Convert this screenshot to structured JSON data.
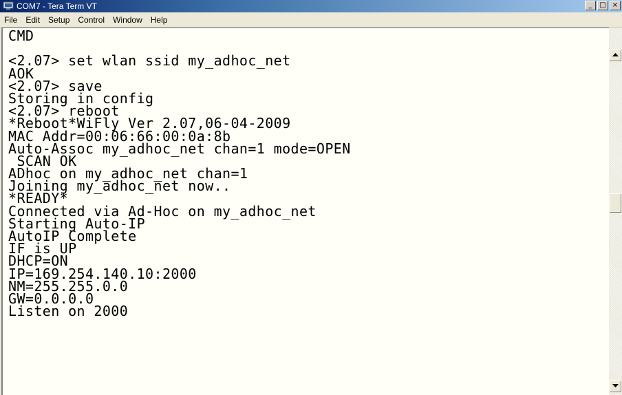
{
  "window": {
    "title": "COM7 - Tera Term VT",
    "app_icon": "tera-term-icon",
    "controls": {
      "minimize": "_",
      "maximize": "□",
      "close": "×"
    }
  },
  "menu": {
    "items": [
      {
        "label": "File"
      },
      {
        "label": "Edit"
      },
      {
        "label": "Setup"
      },
      {
        "label": "Control"
      },
      {
        "label": "Window"
      },
      {
        "label": "Help"
      }
    ]
  },
  "terminal": {
    "lines": [
      "CMD",
      "",
      "<2.07> set wlan ssid my_adhoc_net",
      "AOK",
      "<2.07> save",
      "Storing in config",
      "<2.07> reboot",
      "*Reboot*WiFly Ver 2.07,06-04-2009",
      "MAC Addr=00:06:66:00:0a:8b",
      "Auto-Assoc my_adhoc_net chan=1 mode=OPEN",
      " SCAN OK",
      "ADhoc on my_adhoc_net chan=1",
      "Joining my_adhoc_net now..",
      "*READY*",
      "Connected via Ad-Hoc on my_adhoc_net",
      "Starting Auto-IP",
      "AutoIP Complete",
      "IF is UP",
      "DHCP=ON",
      "IP=169.254.140.10:2000",
      "NM=255.255.0.0",
      "GW=0.0.0.0",
      "Listen on 2000"
    ]
  },
  "scrollbar": {
    "up_icon": "scroll-up-arrow-icon",
    "down_icon": "scroll-down-arrow-icon",
    "position": 0.42
  }
}
